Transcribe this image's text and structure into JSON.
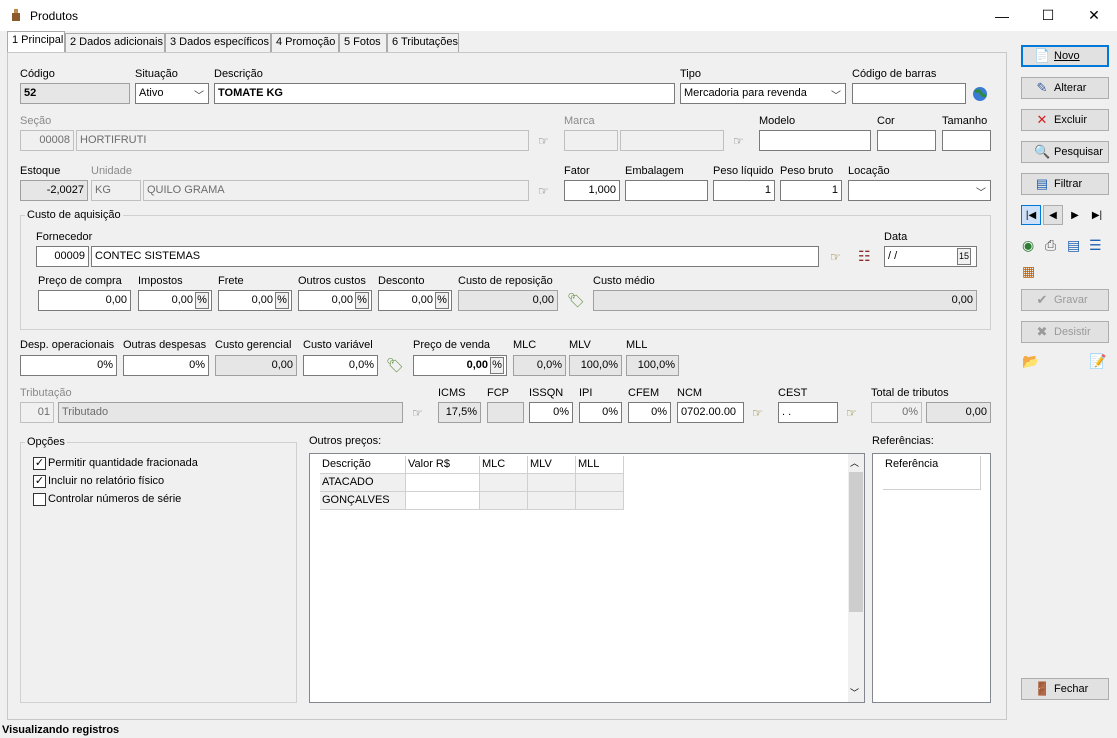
{
  "window": {
    "title": "Produtos",
    "min": "—",
    "max": "☐",
    "close": "✕"
  },
  "tabs": [
    "1 Principal",
    "2 Dados adicionais",
    "3 Dados específicos",
    "4 Promoção",
    "5 Fotos",
    "6 Tributações"
  ],
  "product": {
    "codigo_label": "Código",
    "codigo": "52",
    "situacao_label": "Situação",
    "situacao": "Ativo",
    "descricao_label": "Descrição",
    "descricao": "TOMATE KG",
    "tipo_label": "Tipo",
    "tipo": "Mercadoria para revenda",
    "barras_label": "Código de barras",
    "barras": ""
  },
  "secao": {
    "label": "Seção",
    "code": "00008",
    "name": "HORTIFRUTI",
    "marca_label": "Marca",
    "marca_code": "",
    "marca_name": "",
    "modelo_label": "Modelo",
    "modelo": "",
    "cor_label": "Cor",
    "cor": "",
    "tamanho_label": "Tamanho",
    "tamanho": ""
  },
  "estoque": {
    "label": "Estoque",
    "value": "-2,0027",
    "unidade_label": "Unidade",
    "unidade_code": "KG",
    "unidade_name": "QUILO GRAMA",
    "fator_label": "Fator",
    "fator": "1,000",
    "embalagem_label": "Embalagem",
    "embalagem": "",
    "peso_liq_label": "Peso líquido",
    "peso_liq": "1",
    "peso_bruto_label": "Peso bruto",
    "peso_bruto": "1",
    "locacao_label": "Locação",
    "locacao": ""
  },
  "custo": {
    "group_label": "Custo de aquisição",
    "fornecedor_label": "Fornecedor",
    "fornecedor_code": "00009",
    "fornecedor_name": "CONTEC SISTEMAS",
    "data_label": "Data",
    "data": " / /",
    "preco_compra_label": "Preço de compra",
    "preco_compra": "0,00",
    "impostos_label": "Impostos",
    "impostos": "0,00",
    "frete_label": "Frete",
    "frete": "0,00",
    "outros_label": "Outros custos",
    "outros": "0,00",
    "desconto_label": "Desconto",
    "desconto": "0,00",
    "reposicao_label": "Custo de reposição",
    "reposicao": "0,00",
    "medio_label": "Custo médio",
    "medio": "0,00",
    "pct": "%"
  },
  "venda": {
    "desp_op_label": "Desp. operacionais",
    "desp_op": "0%",
    "outras_desp_label": "Outras despesas",
    "outras_desp": "0%",
    "gerencial_label": "Custo gerencial",
    "gerencial": "0,00",
    "variavel_label": "Custo variável",
    "variavel": "0,0%",
    "preco_venda_label": "Preço de venda",
    "preco_venda": "0,00",
    "mlc_label": "MLC",
    "mlc": "0,0%",
    "mlv_label": "MLV",
    "mlv": "100,0%",
    "mll_label": "MLL",
    "mll": "100,0%"
  },
  "tributacao": {
    "label": "Tributação",
    "code": "01",
    "name": "Tributado",
    "icms_label": "ICMS",
    "icms": "17,5%",
    "fcp_label": "FCP",
    "fcp": "",
    "issqn_label": "ISSQN",
    "issqn": "0%",
    "ipi_label": "IPI",
    "ipi": "0%",
    "cfem_label": "CFEM",
    "cfem": "0%",
    "ncm_label": "NCM",
    "ncm": "0702.00.00",
    "cest_label": "CEST",
    "cest": " .  .",
    "total_label": "Total de tributos",
    "total_pct": "0%",
    "total_val": "0,00"
  },
  "opcoes": {
    "label": "Opções",
    "items": [
      {
        "label": "Permitir quantidade fracionada",
        "checked": "✓"
      },
      {
        "label": "Incluir no relatório físico",
        "checked": "✓"
      },
      {
        "label": "Controlar números de série",
        "checked": ""
      }
    ]
  },
  "outros_precos": {
    "label": "Outros preços:",
    "columns": [
      "Descrição",
      "Valor R$",
      "MLC",
      "MLV",
      "MLL"
    ],
    "rows": [
      "ATACADO",
      "GONÇALVES"
    ]
  },
  "referencias": {
    "label": "Referências:",
    "column": "Referência"
  },
  "buttons": {
    "novo": "Novo",
    "alterar": "Alterar",
    "excluir": "Excluir",
    "pesquisar": "Pesquisar",
    "filtrar": "Filtrar",
    "gravar": "Gravar",
    "desistir": "Desistir",
    "fechar": "Fechar"
  },
  "status": "Visualizando registros",
  "colors": {
    "accent": "#0078d7",
    "panel": "#f0f0f0"
  }
}
